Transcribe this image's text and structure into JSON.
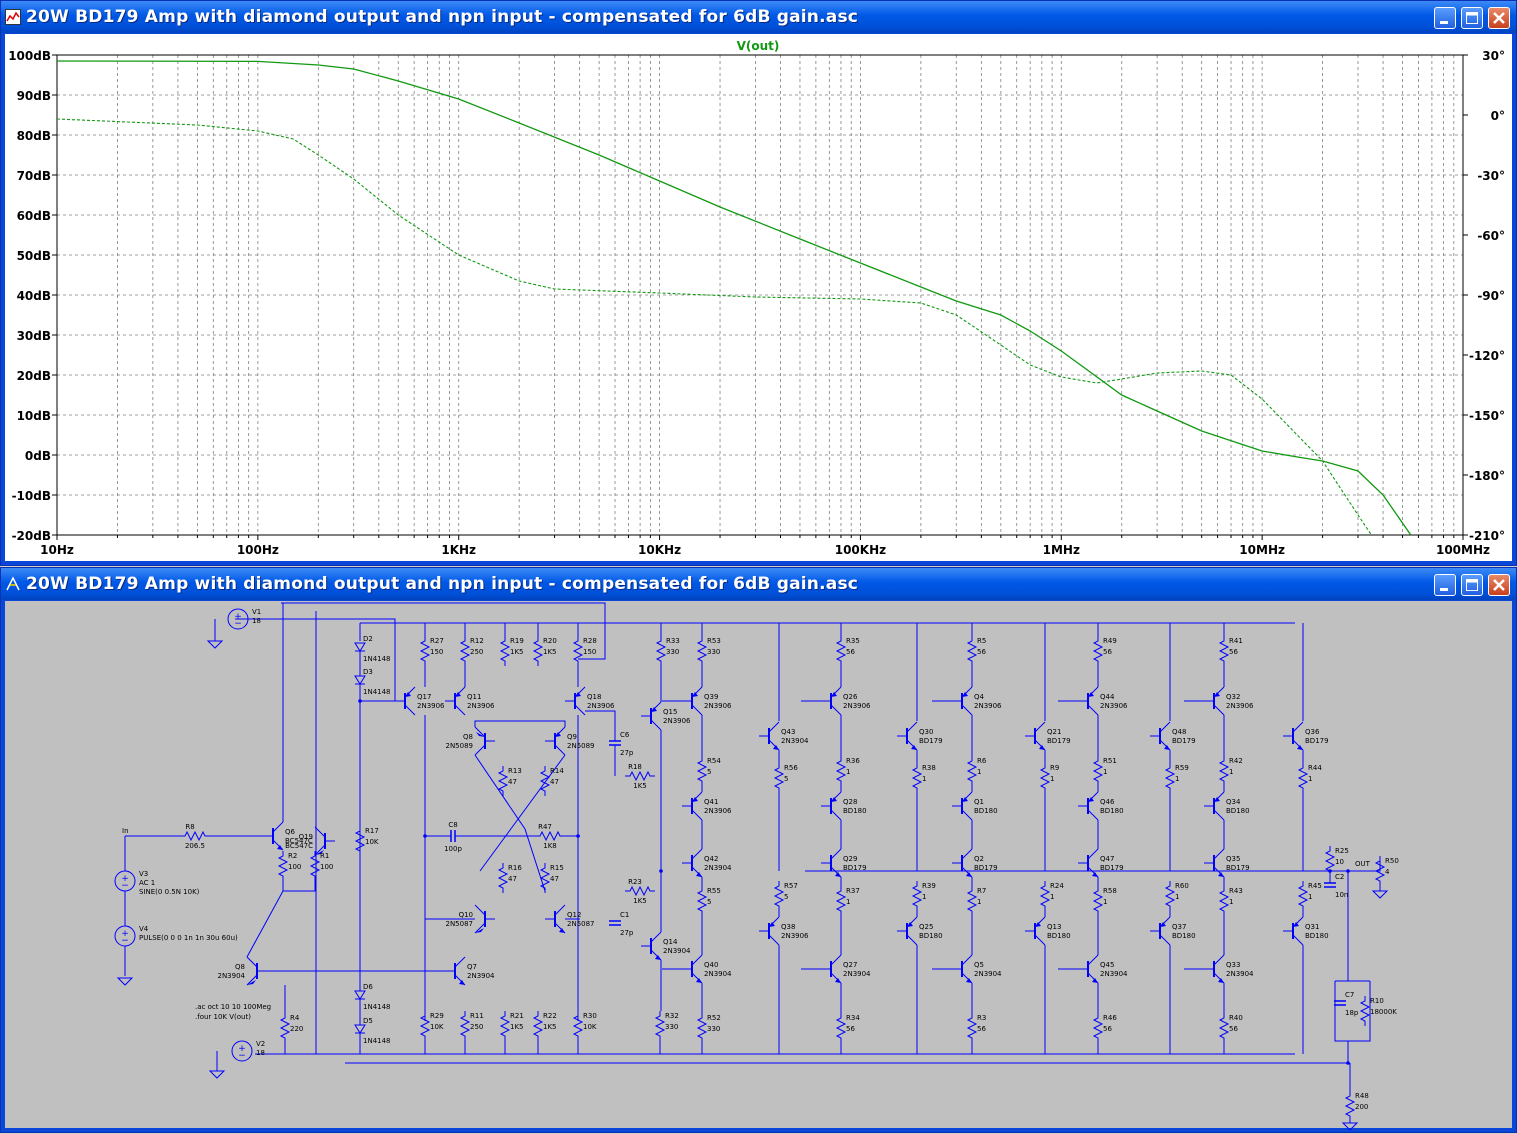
{
  "plot_window": {
    "title": "20W BD179 Amp with diamond output and npn input - compensated for 6dB gain.asc",
    "trace_label": "V(out)"
  },
  "schematic_window": {
    "title": "20W BD179 Amp with diamond output and npn input - compensated for 6dB gain.asc"
  },
  "colors": {
    "trace": "#119911",
    "wire": "#0000ff",
    "grid": "#808080",
    "titlebar": "#0058e6"
  },
  "chart_data": {
    "type": "line",
    "title": "",
    "trace_name": "V(out)",
    "x_scale": "log",
    "xlim": [
      10,
      100000000
    ],
    "x_ticks": [
      "10Hz",
      "100Hz",
      "1KHz",
      "10KHz",
      "100KHz",
      "1MHz",
      "10MHz",
      "100MHz"
    ],
    "y_left_ticks": [
      "100dB",
      "90dB",
      "80dB",
      "70dB",
      "60dB",
      "50dB",
      "40dB",
      "30dB",
      "20dB",
      "10dB",
      "0dB",
      "-10dB",
      "-20dB"
    ],
    "y_left_lim": [
      -20,
      100
    ],
    "y_right_ticks": [
      "30°",
      "0°",
      "-30°",
      "-60°",
      "-90°",
      "-120°",
      "-150°",
      "-180°",
      "-210°"
    ],
    "y_right_lim": [
      -210,
      30
    ],
    "grid": true,
    "series": [
      {
        "kind": "magnitude_dB",
        "style": "solid",
        "points": [
          [
            10,
            98.5
          ],
          [
            100,
            98.4
          ],
          [
            200,
            97.5
          ],
          [
            300,
            96.5
          ],
          [
            500,
            93.5
          ],
          [
            1000,
            89
          ],
          [
            2000,
            83
          ],
          [
            5000,
            75
          ],
          [
            10000,
            68.5
          ],
          [
            20000,
            62
          ],
          [
            50000,
            54
          ],
          [
            100000,
            48
          ],
          [
            200000,
            42
          ],
          [
            300000,
            38.5
          ],
          [
            500000,
            35
          ],
          [
            700000,
            31
          ],
          [
            1000000,
            26
          ],
          [
            2000000,
            15
          ],
          [
            3000000,
            11
          ],
          [
            5000000,
            6
          ],
          [
            10000000,
            1
          ],
          [
            15000000,
            -0.5
          ],
          [
            20000000,
            -1.5
          ],
          [
            30000000,
            -4
          ],
          [
            40000000,
            -10
          ],
          [
            55000000,
            -20
          ]
        ]
      },
      {
        "kind": "phase_deg",
        "style": "dashed",
        "points": [
          [
            10,
            -2
          ],
          [
            50,
            -5
          ],
          [
            100,
            -8
          ],
          [
            150,
            -12
          ],
          [
            200,
            -20
          ],
          [
            300,
            -32
          ],
          [
            500,
            -50
          ],
          [
            1000,
            -70
          ],
          [
            2000,
            -83
          ],
          [
            3000,
            -87
          ],
          [
            10000,
            -89
          ],
          [
            30000,
            -91
          ],
          [
            100000,
            -92
          ],
          [
            200000,
            -94
          ],
          [
            300000,
            -100
          ],
          [
            500000,
            -115
          ],
          [
            700000,
            -125
          ],
          [
            1000000,
            -131
          ],
          [
            1500000,
            -134
          ],
          [
            2000000,
            -132
          ],
          [
            3000000,
            -129
          ],
          [
            5000000,
            -128
          ],
          [
            7000000,
            -130
          ],
          [
            10000000,
            -142
          ],
          [
            20000000,
            -173
          ],
          [
            30000000,
            -200
          ],
          [
            35000000,
            -210
          ]
        ]
      }
    ]
  },
  "schematic": {
    "input_node": "In",
    "output_node": "OUT",
    "spice_directives": [
      ".ac oct 10 10 100Meg",
      ".four 10K V(out)"
    ],
    "sources": [
      {
        "ref": "V1",
        "value": "18"
      },
      {
        "ref": "V2",
        "value": "18"
      },
      {
        "ref": "V3",
        "value": "AC 1",
        "extra": "SINE(0 0.5N 10K)"
      },
      {
        "ref": "V4",
        "value": "PULSE(0 0 0 1n 1n 30u 60u)"
      }
    ],
    "diodes": [
      {
        "ref": "D2",
        "value": "1N4148"
      },
      {
        "ref": "D3",
        "value": "1N4148"
      },
      {
        "ref": "D6",
        "value": "1N4148"
      },
      {
        "ref": "D5",
        "value": "1N4148"
      }
    ],
    "input_stage": [
      {
        "ref": "R8",
        "value": "206.5"
      },
      {
        "ref": "Q6",
        "value": "BC547C"
      },
      {
        "ref": "Q19",
        "value": "BC547C"
      },
      {
        "ref": "R2",
        "value": "100"
      },
      {
        "ref": "R1",
        "value": "100"
      },
      {
        "ref": "R17",
        "value": "10K"
      },
      {
        "ref": "Q8",
        "value": "2N3904"
      },
      {
        "ref": "R4",
        "value": "220"
      }
    ],
    "vas_stage": [
      {
        "ref": "R27",
        "value": "150"
      },
      {
        "ref": "R12",
        "value": "250"
      },
      {
        "ref": "R19",
        "value": "1K5"
      },
      {
        "ref": "R20",
        "value": "1K5"
      },
      {
        "ref": "R28",
        "value": "150"
      },
      {
        "ref": "Q17",
        "value": "2N3906"
      },
      {
        "ref": "Q11",
        "value": "2N3906"
      },
      {
        "ref": "Q18",
        "value": "2N3906"
      },
      {
        "ref": "Q8b",
        "label": "Q8",
        "value": "2N5089"
      },
      {
        "ref": "Q9",
        "value": "2N5089"
      },
      {
        "ref": "R13",
        "value": "47"
      },
      {
        "ref": "R14",
        "value": "47"
      },
      {
        "ref": "C8",
        "value": "100p"
      },
      {
        "ref": "R47",
        "value": "1K8"
      },
      {
        "ref": "R16",
        "value": "47"
      },
      {
        "ref": "R15",
        "value": "47"
      },
      {
        "ref": "Q10",
        "value": "2N5087"
      },
      {
        "ref": "Q12",
        "value": "2N5087"
      },
      {
        "ref": "Q7",
        "value": "2N3904"
      },
      {
        "ref": "R29",
        "value": "10K"
      },
      {
        "ref": "R11",
        "value": "250"
      },
      {
        "ref": "R21",
        "value": "1K5"
      },
      {
        "ref": "R22",
        "value": "1K5"
      },
      {
        "ref": "R30",
        "value": "10K"
      },
      {
        "ref": "C6",
        "value": "27p"
      },
      {
        "ref": "R18",
        "value": "1K5"
      },
      {
        "ref": "R23",
        "value": "1K5"
      },
      {
        "ref": "C1",
        "value": "27p"
      },
      {
        "ref": "Q15",
        "value": "2N3906"
      },
      {
        "ref": "Q14",
        "value": "2N3904"
      },
      {
        "ref": "R33",
        "value": "330"
      },
      {
        "ref": "R32",
        "value": "330"
      }
    ],
    "output_columns": [
      {
        "top_r": [
          "R53",
          "330"
        ],
        "top_q": [
          "Q39",
          "2N3906"
        ],
        "mid_r1": [
          "R54",
          "5"
        ],
        "pnp": [
          "Q41",
          "2N3906"
        ],
        "npn": [
          "Q42",
          "2N3904"
        ],
        "mid_r2": [
          "R55",
          "5"
        ],
        "bot_q": [
          "Q40",
          "2N3904"
        ],
        "bot_r": [
          "R52",
          "330"
        ]
      },
      {
        "top_r": [
          "R35",
          "56"
        ],
        "top_q": [
          "Q26",
          "2N3906"
        ],
        "mid_r1": [
          "R36",
          "1"
        ],
        "pnp": [
          "Q28",
          "BD180"
        ],
        "npn": [
          "Q29",
          "BD179"
        ],
        "mid_r2": [
          "R37",
          "1"
        ],
        "bot_q": [
          "Q27",
          "2N3904"
        ],
        "bot_r": [
          "R34",
          "56"
        ]
      },
      {
        "top_r": [
          "R5",
          "56"
        ],
        "top_q": [
          "Q4",
          "2N3906"
        ],
        "mid_r1": [
          "R6",
          "1"
        ],
        "pnp": [
          "Q1",
          "BD180"
        ],
        "npn": [
          "Q2",
          "BD179"
        ],
        "mid_r2": [
          "R7",
          "1"
        ],
        "bot_q": [
          "Q5",
          "2N3904"
        ],
        "bot_r": [
          "R3",
          "56"
        ]
      },
      {
        "top_r": [
          "R49",
          "56"
        ],
        "top_q": [
          "Q44",
          "2N3906"
        ],
        "mid_r1": [
          "R51",
          "1"
        ],
        "pnp": [
          "Q46",
          "BD180"
        ],
        "npn": [
          "Q47",
          "BD179"
        ],
        "mid_r2": [
          "R58",
          "1"
        ],
        "bot_q": [
          "Q45",
          "2N3904"
        ],
        "bot_r": [
          "R46",
          "56"
        ]
      },
      {
        "top_r": [
          "R41",
          "56"
        ],
        "top_q": [
          "Q32",
          "2N3906"
        ],
        "mid_r1": [
          "R42",
          "1"
        ],
        "pnp": [
          "Q34",
          "BD180"
        ],
        "npn": [
          "Q35",
          "BD179"
        ],
        "mid_r2": [
          "R43",
          "1"
        ],
        "bot_q": [
          "Q33",
          "2N3904"
        ],
        "bot_r": [
          "R40",
          "56"
        ]
      }
    ],
    "driver_columns": [
      {
        "upper_q": [
          "Q43",
          "2N3904"
        ],
        "upper_r": [
          "R56",
          "5"
        ],
        "lower_r": [
          "R57",
          "5"
        ],
        "lower_q": [
          "Q38",
          "2N3906"
        ]
      },
      {
        "upper_q": [
          "Q30",
          "BD179"
        ],
        "upper_r": [
          "R38",
          "1"
        ],
        "lower_r": [
          "R39",
          "1"
        ],
        "lower_q": [
          "Q25",
          "BD180"
        ]
      },
      {
        "upper_q": [
          "Q21",
          "BD179"
        ],
        "upper_r": [
          "R9",
          "1"
        ],
        "lower_r": [
          "R24",
          "1"
        ],
        "lower_q": [
          "Q13",
          "BD180"
        ]
      },
      {
        "upper_q": [
          "Q48",
          "BD179"
        ],
        "upper_r": [
          "R59",
          "1"
        ],
        "lower_r": [
          "R60",
          "1"
        ],
        "lower_q": [
          "Q37",
          "BD180"
        ]
      },
      {
        "upper_q": [
          "Q36",
          "BD179"
        ],
        "upper_r": [
          "R44",
          "1"
        ],
        "lower_r": [
          "R45",
          "1"
        ],
        "lower_q": [
          "Q31",
          "BD180"
        ]
      }
    ],
    "load": [
      {
        "ref": "R25",
        "value": "10"
      },
      {
        "ref": "C2",
        "value": "10n"
      },
      {
        "ref": "R50",
        "value": "4"
      },
      {
        "ref": "C7",
        "value": "18p"
      },
      {
        "ref": "R10",
        "value": "18000K"
      },
      {
        "ref": "R48",
        "value": "200"
      }
    ]
  }
}
